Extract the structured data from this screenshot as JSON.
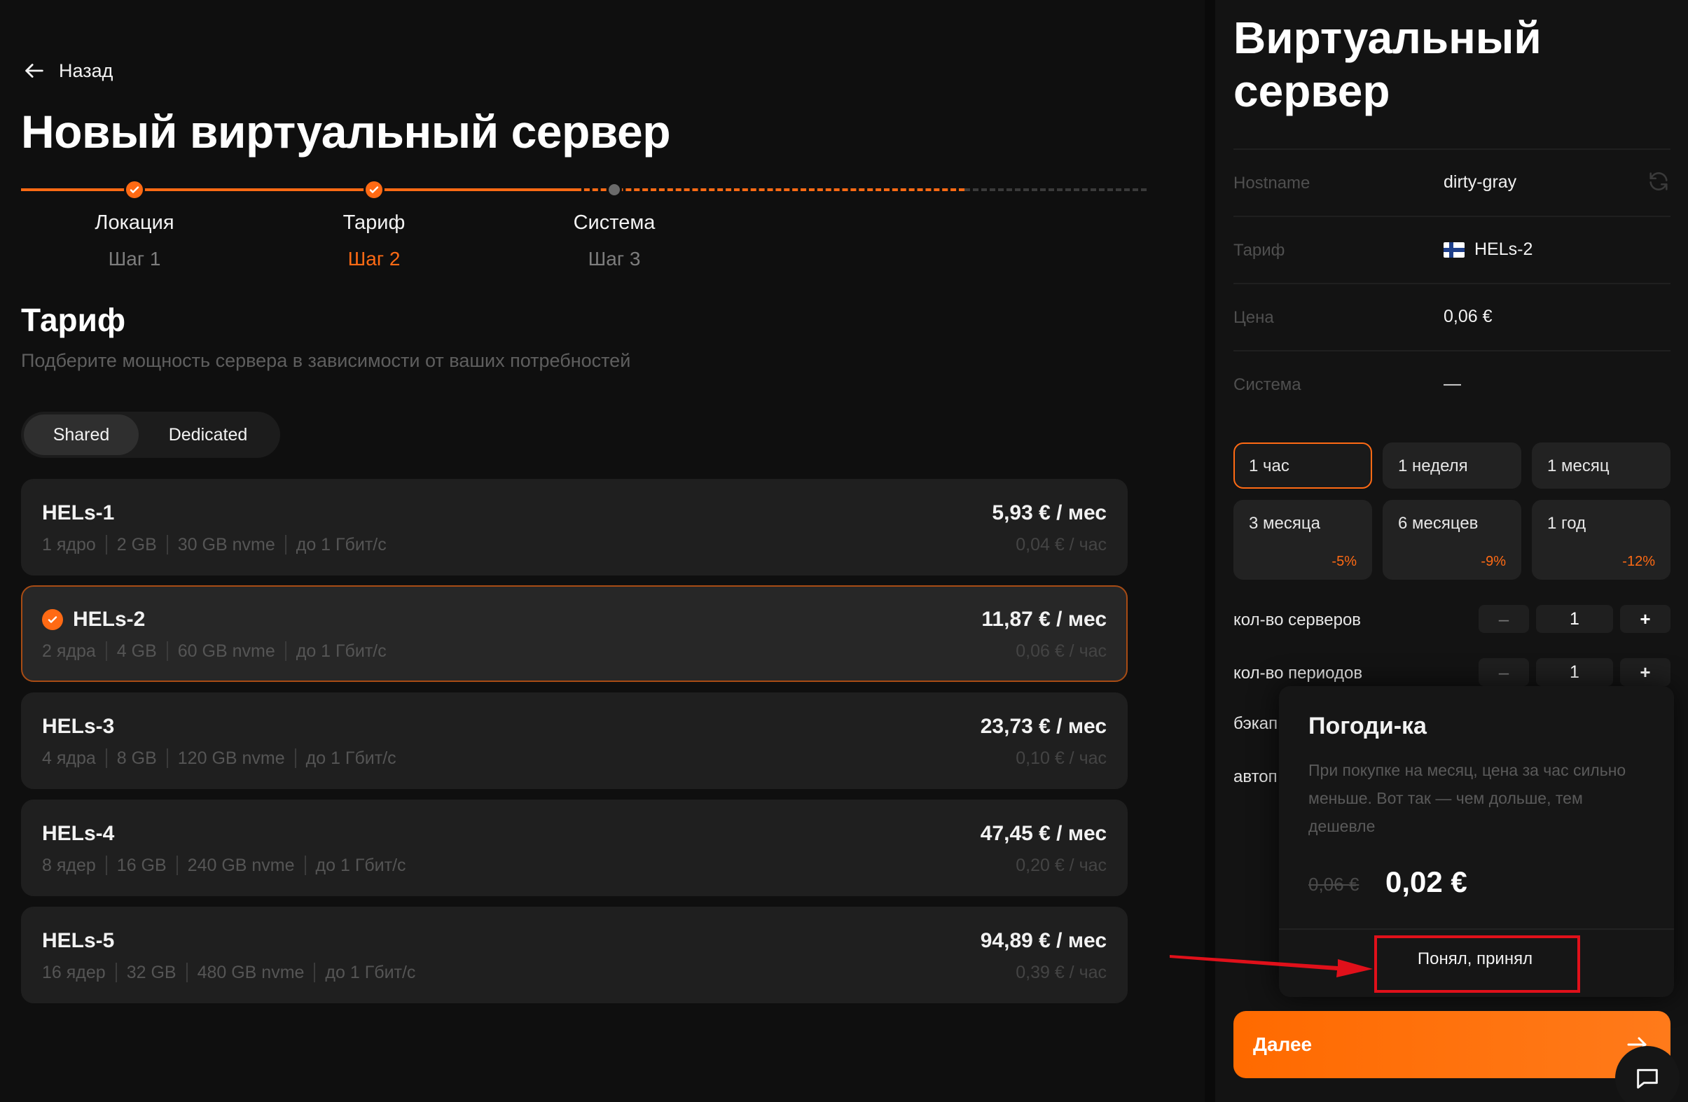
{
  "header": {
    "back_label": "Назад",
    "title": "Новый виртуальный сервер"
  },
  "stepper": {
    "steps": [
      {
        "label": "Локация",
        "sub": "Шаг 1",
        "state": "done"
      },
      {
        "label": "Тариф",
        "sub": "Шаг 2",
        "state": "active"
      },
      {
        "label": "Система",
        "sub": "Шаг 3",
        "state": "pending"
      }
    ]
  },
  "tariff": {
    "title": "Тариф",
    "subtitle": "Подберите мощность сервера в зависимости от ваших потребностей",
    "toggle": [
      "Shared",
      "Dedicated"
    ],
    "plans": [
      {
        "name": "HELs-1",
        "cpu": "1 ядро",
        "ram": "2 GB",
        "disk": "30 GB nvme",
        "net": "до 1 Гбит/с",
        "price": "5,93 € / мес",
        "hour": "0,04 € / час",
        "selected": false
      },
      {
        "name": "HELs-2",
        "cpu": "2 ядра",
        "ram": "4 GB",
        "disk": "60 GB nvme",
        "net": "до 1 Гбит/с",
        "price": "11,87 € / мес",
        "hour": "0,06 € / час",
        "selected": true
      },
      {
        "name": "HELs-3",
        "cpu": "4 ядра",
        "ram": "8 GB",
        "disk": "120 GB nvme",
        "net": "до 1 Гбит/с",
        "price": "23,73 € / мес",
        "hour": "0,10 € / час",
        "selected": false
      },
      {
        "name": "HELs-4",
        "cpu": "8 ядер",
        "ram": "16 GB",
        "disk": "240 GB nvme",
        "net": "до 1 Гбит/с",
        "price": "47,45 € / мес",
        "hour": "0,20 € / час",
        "selected": false
      },
      {
        "name": "HELs-5",
        "cpu": "16 ядер",
        "ram": "32 GB",
        "disk": "480 GB nvme",
        "net": "до 1 Гбит/с",
        "price": "94,89 € / мес",
        "hour": "0,39 € / час",
        "selected": false
      }
    ]
  },
  "summary": {
    "title": "Виртуальный сервер",
    "rows": [
      {
        "key": "Hostname",
        "value": "dirty-gray"
      },
      {
        "key": "Тариф",
        "value": "HELs-2"
      },
      {
        "key": "Цена",
        "value": "0,06 €"
      },
      {
        "key": "Система",
        "value": "—"
      }
    ],
    "periods": [
      {
        "label": "1 час",
        "discount": ""
      },
      {
        "label": "1 неделя",
        "discount": ""
      },
      {
        "label": "1 месяц",
        "discount": ""
      },
      {
        "label": "3 месяца",
        "discount": "-5%"
      },
      {
        "label": "6 месяцев",
        "discount": "-9%"
      },
      {
        "label": "1 год",
        "discount": "-12%"
      }
    ],
    "servers_label": "кол-во серверов",
    "servers_count": "1",
    "periods_label": "кол-во периодов",
    "periods_count": "1",
    "minus": "–",
    "plus": "+",
    "backup_partial": "бэкап",
    "auto_partial": "автоп",
    "next_label": "Далее"
  },
  "popup": {
    "title": "Погоди-ка",
    "text": "При покупке на месяц, цена за час сильно меньше. Вот так — чем дольше, тем дешевле",
    "old_price": "0,06 €",
    "new_price": "0,02 €",
    "ok_label": "Понял, принял"
  },
  "colors": {
    "accent": "#ff6a14",
    "background": "#0f0f0f",
    "card": "#1f1f1f",
    "annotation": "#e0101a"
  }
}
